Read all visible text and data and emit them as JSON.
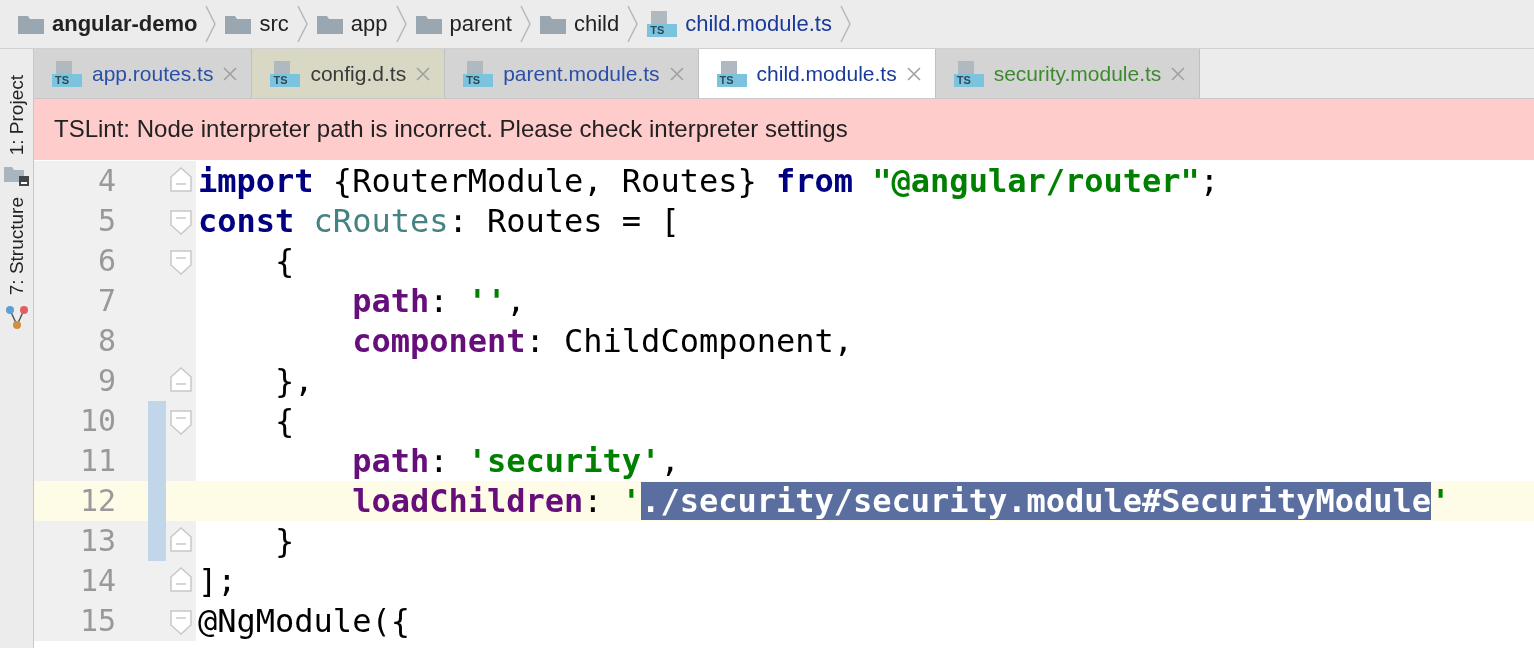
{
  "breadcrumbs": [
    {
      "label": "angular-demo",
      "kind": "folder",
      "bold": true
    },
    {
      "label": "src",
      "kind": "folder",
      "bold": false
    },
    {
      "label": "app",
      "kind": "folder",
      "bold": false
    },
    {
      "label": "parent",
      "kind": "folder",
      "bold": false
    },
    {
      "label": "child",
      "kind": "folder",
      "bold": false
    },
    {
      "label": "child.module.ts",
      "kind": "file",
      "bold": false,
      "icon_text": "TS"
    }
  ],
  "side_tools": [
    {
      "label": "1: Project",
      "kind": "folder"
    },
    {
      "label": "7: Structure",
      "kind": "structure"
    }
  ],
  "tabs": [
    {
      "label": "app.routes.ts",
      "icon_text": "TS",
      "selected": false,
      "color": "#2b4fa8",
      "kind": "project"
    },
    {
      "label": "config.d.ts",
      "icon_text": "TS",
      "selected": false,
      "color": "#3a3a3a",
      "kind": "library"
    },
    {
      "label": "parent.module.ts",
      "icon_text": "TS",
      "selected": false,
      "color": "#2b4fa8",
      "kind": "project"
    },
    {
      "label": "child.module.ts",
      "icon_text": "TS",
      "selected": true,
      "color": "#1a3a9a",
      "kind": "project"
    },
    {
      "label": "security.module.ts",
      "icon_text": "TS",
      "selected": false,
      "color": "#3d8a2e",
      "kind": "project"
    }
  ],
  "banner": {
    "text": "TSLint: Node interpreter path is incorrect. Please check interpreter settings"
  },
  "code_lines": [
    {
      "number": "4",
      "fold_start": false,
      "fold_end": true,
      "changed": false,
      "current": false,
      "tokens": [
        {
          "kind": "keyword",
          "text": "import"
        },
        {
          "kind": "plain",
          "text": " {RouterModule, Routes} "
        },
        {
          "kind": "keyword",
          "text": "from "
        },
        {
          "kind": "string",
          "text": "\"@angular/router\""
        },
        {
          "kind": "plain",
          "text": ";"
        }
      ]
    },
    {
      "number": "5",
      "fold_start": true,
      "fold_end": false,
      "changed": false,
      "current": false,
      "tokens": [
        {
          "kind": "keyword",
          "text": "const "
        },
        {
          "kind": "variable",
          "text": "cRoutes"
        },
        {
          "kind": "plain",
          "text": ": Routes = ["
        }
      ]
    },
    {
      "number": "6",
      "fold_start": true,
      "fold_end": false,
      "changed": false,
      "current": false,
      "tokens": [
        {
          "kind": "plain",
          "text": "    {"
        }
      ]
    },
    {
      "number": "7",
      "fold_start": false,
      "fold_end": false,
      "changed": false,
      "current": false,
      "tokens": [
        {
          "kind": "property",
          "text": "        path"
        },
        {
          "kind": "plain",
          "text": ": "
        },
        {
          "kind": "string",
          "text": "''"
        },
        {
          "kind": "plain",
          "text": ","
        }
      ]
    },
    {
      "number": "8",
      "fold_start": false,
      "fold_end": false,
      "changed": false,
      "current": false,
      "tokens": [
        {
          "kind": "property",
          "text": "        component"
        },
        {
          "kind": "plain",
          "text": ": ChildComponent,"
        }
      ]
    },
    {
      "number": "9",
      "fold_start": false,
      "fold_end": true,
      "changed": false,
      "current": false,
      "tokens": [
        {
          "kind": "plain",
          "text": "    },"
        }
      ]
    },
    {
      "number": "10",
      "fold_start": true,
      "fold_end": false,
      "changed": true,
      "current": false,
      "tokens": [
        {
          "kind": "plain",
          "text": "    {"
        }
      ]
    },
    {
      "number": "11",
      "fold_start": false,
      "fold_end": false,
      "changed": true,
      "current": false,
      "tokens": [
        {
          "kind": "property",
          "text": "        path"
        },
        {
          "kind": "plain",
          "text": ": "
        },
        {
          "kind": "string",
          "text": "'security'"
        },
        {
          "kind": "plain",
          "text": ","
        }
      ]
    },
    {
      "number": "12",
      "fold_start": false,
      "fold_end": false,
      "changed": true,
      "current": true,
      "tokens": [
        {
          "kind": "property",
          "text": "        loadChildren"
        },
        {
          "kind": "plain",
          "text": ": "
        },
        {
          "kind": "string",
          "text": "'"
        },
        {
          "kind": "selected",
          "text": "./security/security.module#SecurityModule"
        },
        {
          "kind": "string",
          "text": "'"
        }
      ]
    },
    {
      "number": "13",
      "fold_start": false,
      "fold_end": true,
      "changed": true,
      "current": false,
      "tokens": [
        {
          "kind": "plain",
          "text": "    }"
        }
      ]
    },
    {
      "number": "14",
      "fold_start": false,
      "fold_end": true,
      "changed": false,
      "current": false,
      "tokens": [
        {
          "kind": "plain",
          "text": "];"
        }
      ]
    },
    {
      "number": "15",
      "fold_start": true,
      "fold_end": false,
      "changed": false,
      "current": false,
      "tokens": [
        {
          "kind": "plain",
          "text": "@NgModule({"
        }
      ]
    }
  ]
}
